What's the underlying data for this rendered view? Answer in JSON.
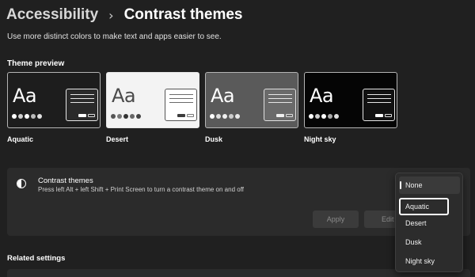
{
  "breadcrumb": {
    "parent": "Accessibility",
    "separator": "›",
    "current": "Contrast themes"
  },
  "description": "Use more distinct colors to make text and apps easier to see.",
  "theme_preview": {
    "label": "Theme preview",
    "sample_text": "Aa",
    "themes": [
      {
        "name": "Aquatic"
      },
      {
        "name": "Desert"
      },
      {
        "name": "Dusk"
      },
      {
        "name": "Night sky"
      }
    ]
  },
  "contrast_card": {
    "icon": "contrast-icon",
    "title": "Contrast themes",
    "description": "Press left Alt + left Shift + Print Screen to turn a contrast theme on and off",
    "apply_label": "Apply",
    "edit_label": "Edit"
  },
  "dropdown": {
    "selected": "None",
    "highlighted": "Aquatic",
    "options": [
      "None",
      "Aquatic",
      "Desert",
      "Dusk",
      "Night sky"
    ]
  },
  "related_settings": {
    "label": "Related settings"
  },
  "colors": {
    "background": "#202020",
    "card": "#2b2b2b",
    "text": "#ffffff"
  }
}
